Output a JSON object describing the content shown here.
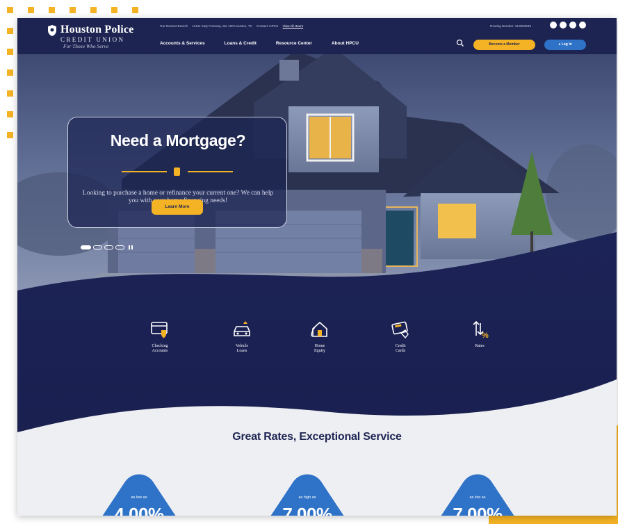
{
  "brand": {
    "name": "Houston Police",
    "sub": "CREDIT UNION",
    "tagline": "For Those Who Serve",
    "colors": {
      "navy": "#1d2452",
      "gold": "#f4b324",
      "blue": "#2f73c8"
    }
  },
  "topbar": {
    "items": [
      "Our Newest Branch",
      "11411 Katy Freeway, Ste 100 Houston, TX",
      "Contact: HPCU",
      "View All Hours"
    ],
    "routing": "Routing Number: 313083646",
    "socials": [
      "instagram-icon",
      "facebook-icon",
      "twitter-icon",
      "linkedin-icon"
    ]
  },
  "nav": {
    "items": [
      "Accounts & Services",
      "Loans & Credit",
      "Resource Center",
      "About HPCU"
    ],
    "become_member": "Become a Member",
    "login": "Log In"
  },
  "hero": {
    "title": "Need a Mortgage?",
    "text": "Looking to purchase a home or refinance your current one? We can help you with your home financing needs!",
    "button": "Learn More",
    "slides": 4,
    "active_slide": 1
  },
  "quick_links": [
    {
      "label": "Checking\nAccounts",
      "icon": "checking-card-icon"
    },
    {
      "label": "Vehicle\nLoans",
      "icon": "vehicle-icon"
    },
    {
      "label": "Home\nEquity",
      "icon": "home-equity-icon"
    },
    {
      "label": "Credit\nCards",
      "icon": "credit-card-icon"
    },
    {
      "label": "Rates",
      "icon": "rates-icon"
    }
  ],
  "rates_section": {
    "title": "Great Rates, Exceptional Service",
    "cards": [
      {
        "prefix": "as low as",
        "value": "4.00%"
      },
      {
        "prefix": "as high as",
        "value": "7.00%"
      },
      {
        "prefix": "as low as",
        "value": "7.00%"
      }
    ]
  }
}
